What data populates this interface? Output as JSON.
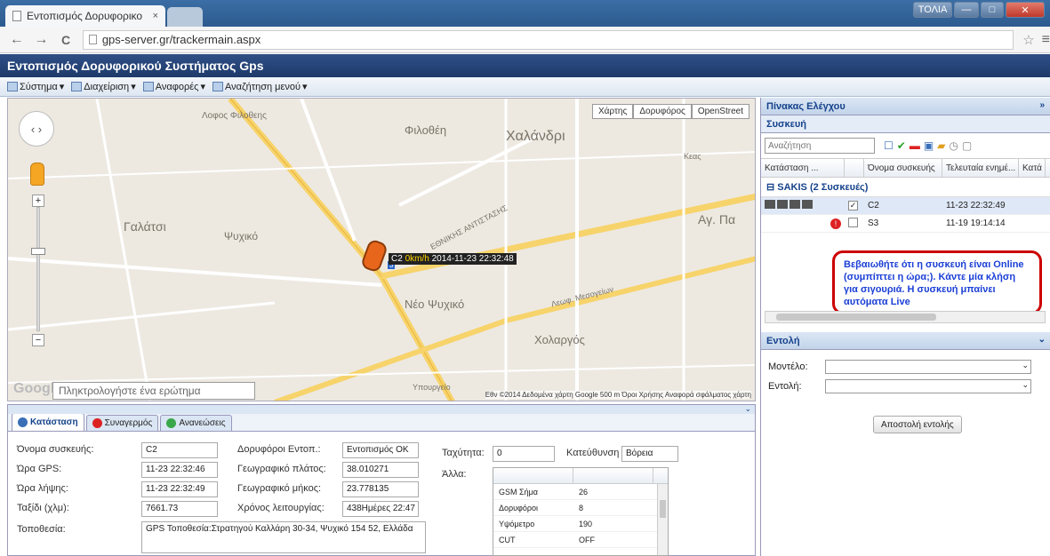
{
  "browser": {
    "tab_title": "Εντοπισμός Δορυφορικο",
    "tab_close": "×",
    "url": "gps-server.gr/trackermain.aspx",
    "user_button": "ΤΟΛΙΑ",
    "back": "←",
    "forward": "→",
    "reload": "C"
  },
  "app": {
    "title": "Εντοπισμός Δορυφορικού Συστήματος Gps",
    "menu": [
      {
        "label": "Σύστημα",
        "icon": "system-icon"
      },
      {
        "label": "Διαχείριση",
        "icon": "manage-icon"
      },
      {
        "label": "Αναφορές",
        "icon": "reports-icon"
      },
      {
        "label": "Αναζήτηση μενού",
        "icon": "search-menu-icon"
      }
    ]
  },
  "map": {
    "map_types": [
      "Χάρτης",
      "Δορυφόρος",
      "OpenStreet"
    ],
    "labels": [
      "Λοφος Φιλοθεης",
      "Φιλοθέη",
      "Χαλάνδρι",
      "Γαλάτσι",
      "Ψυχικό",
      "Νέο Ψυχικό",
      "Χολαργός",
      "Υπουργείο",
      "Αγ. Πα",
      "Λεωφ. Μεσογείων",
      "Κεας",
      "ΕΘΝΙΚΗΣ ΑΝΤΙΣΤΑΣΗΣ"
    ],
    "marker": {
      "name": "C2",
      "speed": "0km/h",
      "time": "2014-11-23 22:32:48",
      "badge": "3"
    },
    "search_placeholder": "Πληκτρολογήστε ένα ερώτημα",
    "google": "Google",
    "attribution": "Εθν ©2014 Δεδομένα χάρτη Google   500 m      Όροι Χρήσης   Αναφορά σφάλματος χάρτη"
  },
  "control_panel": {
    "title": "Πίνακας Ελέγχου",
    "device_section": "Συσκευή",
    "search_placeholder": "Αναζήτηση",
    "columns": [
      "Κατάσταση ...",
      "",
      "Όνομα συσκευής",
      "Τελευταία ενημέ...",
      "Κατά"
    ],
    "group": "SAKIS (2 Συσκευές)",
    "devices": [
      {
        "name": "C2",
        "updated": "11-23 22:32:49",
        "checked": "✓"
      },
      {
        "name": "S3",
        "updated": "11-19 19:14:14",
        "checked": ""
      }
    ],
    "notice": "Βεβαιωθήτε ότι η συσκευή είναι Online (συμπίπτει η ώρα;). Κάντε μία κλήση για σιγουριά. Η συσκευή μπαίνει αυτόματα Live",
    "command_section": "Εντολή",
    "model_label": "Μοντέλο:",
    "command_label": "Εντολή:",
    "send_button": "Αποστολή εντολής"
  },
  "status_panel": {
    "tabs": [
      "Κατάσταση",
      "Συναγερμός",
      "Ανανεώσεις"
    ],
    "fields": {
      "device_name_label": "Όνομα συσκευής:",
      "device_name": "C2",
      "gps_time_label": "Ώρα GPS:",
      "gps_time": "11-23 22:32:46",
      "recv_time_label": "Ώρα λήψης:",
      "recv_time": "11-23 22:32:49",
      "trip_label": "Ταξίδι (χλμ):",
      "trip": "7661.73",
      "location_label": "Τοποθεσία:",
      "location": "GPS Τοποθεσία:Στρατηγού Καλλάρη 30-34, Ψυχικό 154 52, Ελλάδα",
      "sats_label": "Δορυφόροι Εντοπ.:",
      "sats": "Εντοπισμός ΟΚ",
      "lat_label": "Γεωγραφικό πλάτος:",
      "lat": "38.010271",
      "lng_label": "Γεωγραφικό μήκος:",
      "lng": "23.778135",
      "uptime_label": "Χρόνος λειτουργίας:",
      "uptime": "438Ημέρες 22:47",
      "speed_label": "Ταχύτητα:",
      "speed": "0",
      "direction_label": "Κατεύθυνση",
      "direction": "Βόρεια",
      "other_label": "Άλλα:"
    },
    "other": [
      {
        "k": "GSM Σήμα",
        "v": "26"
      },
      {
        "k": "Δορυφόροι",
        "v": "8"
      },
      {
        "k": "Υψόμετρο",
        "v": "190"
      },
      {
        "k": "CUT",
        "v": "OFF"
      }
    ]
  }
}
